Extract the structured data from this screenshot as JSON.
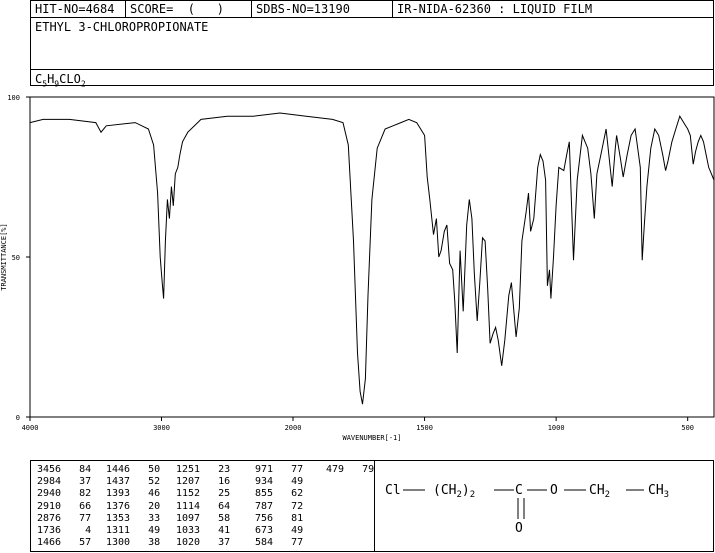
{
  "header": {
    "hit_no": "HIT-NO=4684",
    "score": "SCORE=  (   )",
    "sdbs_no": "SDBS-NO=13190",
    "ir_info": "IR-NIDA-62360 : LIQUID FILM",
    "compound": "ETHYL 3-CHLOROPROPIONATE",
    "formula": {
      "c": "C",
      "c_n": "5",
      "h": "H",
      "h_n": "9",
      "cl_o": "CLO",
      "o_n": "2"
    }
  },
  "chart_data": {
    "type": "line",
    "xlabel": "WAVENUMBER[-1]",
    "ylabel": "TRANSMITTANCE[%]",
    "xlim": [
      4000,
      400
    ],
    "ylim": [
      0,
      100
    ],
    "x_ticks": [
      4000,
      3000,
      2000,
      1500,
      1000,
      500
    ],
    "y_ticks": [
      0,
      50,
      100
    ],
    "series": [
      {
        "x": [
          4000,
          3900,
          3700,
          3500,
          3460,
          3420,
          3200,
          3100,
          3060,
          3030,
          3010,
          2995,
          2984,
          2970,
          2955,
          2940,
          2925,
          2910,
          2895,
          2876,
          2860,
          2840,
          2800,
          2700,
          2500,
          2300,
          2100,
          1950,
          1850,
          1810,
          1790,
          1770,
          1755,
          1745,
          1736,
          1725,
          1715,
          1700,
          1680,
          1650,
          1620,
          1590,
          1560,
          1530,
          1500,
          1490,
          1480,
          1466,
          1455,
          1446,
          1437,
          1425,
          1415,
          1405,
          1393,
          1385,
          1376,
          1365,
          1353,
          1340,
          1330,
          1320,
          1311,
          1300,
          1290,
          1280,
          1270,
          1260,
          1251,
          1240,
          1230,
          1220,
          1207,
          1195,
          1180,
          1170,
          1152,
          1140,
          1130,
          1114,
          1105,
          1097,
          1085,
          1070,
          1060,
          1050,
          1040,
          1033,
          1025,
          1020,
          1010,
          1000,
          990,
          971,
          960,
          950,
          934,
          920,
          900,
          880,
          868,
          855,
          845,
          830,
          810,
          787,
          775,
          770,
          756,
          745,
          730,
          715,
          700,
          690,
          680,
          673,
          665,
          655,
          640,
          625,
          610,
          595,
          584,
          575,
          560,
          545,
          530,
          515,
          500,
          490,
          479,
          470,
          460,
          450,
          440,
          430,
          420,
          410,
          400
        ],
        "y": [
          92,
          93,
          93,
          92,
          89,
          91,
          92,
          90,
          85,
          70,
          50,
          42,
          37,
          55,
          68,
          62,
          72,
          66,
          76,
          78,
          82,
          86,
          89,
          93,
          94,
          94,
          95,
          94,
          93,
          92,
          85,
          55,
          20,
          8,
          4,
          12,
          38,
          68,
          84,
          90,
          91,
          92,
          93,
          92,
          88,
          75,
          68,
          57,
          62,
          50,
          52,
          58,
          60,
          48,
          46,
          36,
          20,
          52,
          33,
          60,
          68,
          62,
          45,
          30,
          42,
          56,
          55,
          40,
          23,
          26,
          28,
          24,
          16,
          24,
          38,
          42,
          25,
          34,
          55,
          64,
          70,
          58,
          62,
          78,
          82,
          80,
          74,
          41,
          46,
          37,
          50,
          66,
          78,
          77,
          82,
          86,
          49,
          74,
          88,
          84,
          76,
          62,
          76,
          82,
          90,
          72,
          84,
          88,
          81,
          75,
          82,
          88,
          90,
          84,
          78,
          49,
          60,
          72,
          84,
          90,
          88,
          82,
          77,
          80,
          86,
          90,
          94,
          92,
          90,
          88,
          79,
          83,
          86,
          88,
          86,
          82,
          78,
          76,
          74
        ]
      }
    ]
  },
  "peaks": {
    "col1": [
      [
        "3456",
        "84"
      ],
      [
        "2984",
        "37"
      ],
      [
        "2940",
        "82"
      ],
      [
        "2910",
        "66"
      ],
      [
        "2876",
        "77"
      ],
      [
        "1736",
        "4"
      ],
      [
        "1466",
        "57"
      ]
    ],
    "col2": [
      [
        "1446",
        "50"
      ],
      [
        "1437",
        "52"
      ],
      [
        "1393",
        "46"
      ],
      [
        "1376",
        "20"
      ],
      [
        "1353",
        "33"
      ],
      [
        "1311",
        "49"
      ],
      [
        "1300",
        "38"
      ]
    ],
    "col3": [
      [
        "1251",
        "23"
      ],
      [
        "1207",
        "16"
      ],
      [
        "1152",
        "25"
      ],
      [
        "1114",
        "64"
      ],
      [
        "1097",
        "58"
      ],
      [
        "1033",
        "41"
      ],
      [
        "1020",
        "37"
      ]
    ],
    "col4": [
      [
        "971",
        "77"
      ],
      [
        "934",
        "49"
      ],
      [
        "855",
        "62"
      ],
      [
        "787",
        "72"
      ],
      [
        "756",
        "81"
      ],
      [
        "673",
        "49"
      ],
      [
        "584",
        "77"
      ]
    ],
    "col5": [
      [
        "479",
        "79"
      ]
    ]
  },
  "structure": {
    "cl": "Cl",
    "ch2_group": "(CH",
    "ch2_sub": "2",
    "ch2_close": ")",
    "ch2_count": "2",
    "c": "C",
    "o_ether": "O",
    "ch2b": "CH",
    "ch2b_sub": "2",
    "ch3": "CH",
    "ch3_sub": "3",
    "o_carbonyl": "O"
  }
}
